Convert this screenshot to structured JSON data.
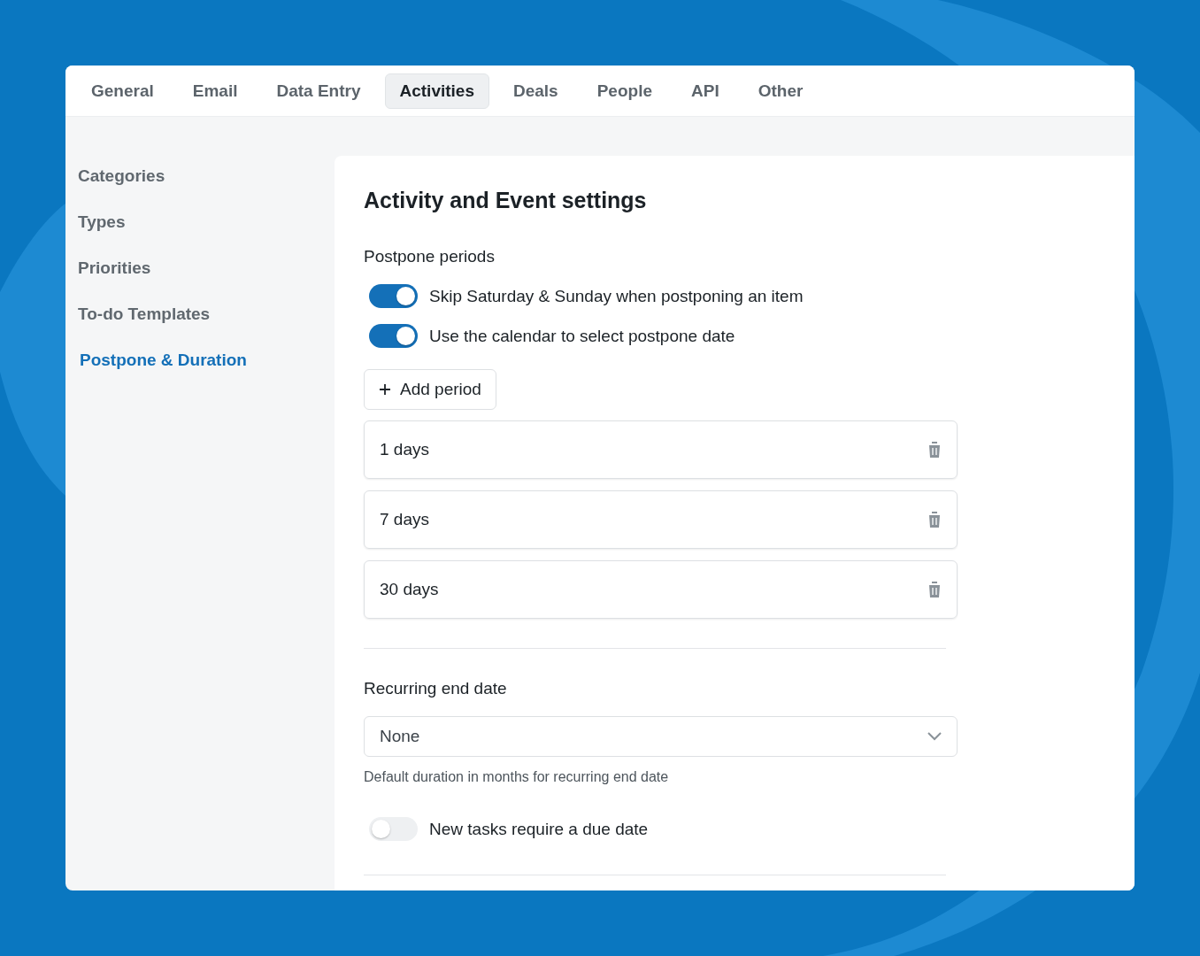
{
  "tabs": [
    {
      "label": "General",
      "selected": false
    },
    {
      "label": "Email",
      "selected": false
    },
    {
      "label": "Data Entry",
      "selected": false
    },
    {
      "label": "Activities",
      "selected": true
    },
    {
      "label": "Deals",
      "selected": false
    },
    {
      "label": "People",
      "selected": false
    },
    {
      "label": "API",
      "selected": false
    },
    {
      "label": "Other",
      "selected": false
    }
  ],
  "sidebar": {
    "items": [
      {
        "label": "Categories",
        "selected": false
      },
      {
        "label": "Types",
        "selected": false
      },
      {
        "label": "Priorities",
        "selected": false
      },
      {
        "label": "To-do Templates",
        "selected": false
      },
      {
        "label": "Postpone & Duration",
        "selected": true
      }
    ]
  },
  "content": {
    "title": "Activity and Event settings",
    "postpone": {
      "heading": "Postpone periods",
      "toggles": [
        {
          "label": "Skip Saturday & Sunday when postponing an item",
          "on": true
        },
        {
          "label": "Use the calendar to select postpone date",
          "on": true
        }
      ],
      "add_button": "Add period",
      "periods": [
        "1 days",
        "7 days",
        "30 days"
      ]
    },
    "recurring": {
      "heading": "Recurring end date",
      "select_value": "None",
      "help": "Default duration in months for recurring end date",
      "toggle": {
        "label": "New tasks require a due date",
        "on": false
      }
    }
  }
}
